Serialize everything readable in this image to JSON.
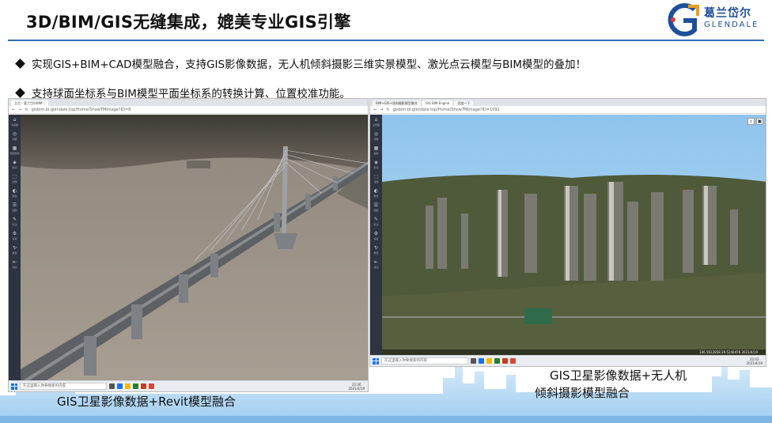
{
  "header": {
    "title": "3D/BIM/GIS无缝集成，媲美专业GIS引擎",
    "logo_cn": "葛兰岱尔",
    "logo_en": "GLENDALE"
  },
  "bullets": [
    "实现GIS+BIM+CAD模型融合，支持GIS影像数据，无人机倾斜摄影三维实景模型、激光点云模型与BIM模型的叠加！",
    "支持球面坐标系与BIM模型平面坐标系的转换计算、位置校准功能。"
  ],
  "left_window": {
    "tab": "主页 - 葛兰岱尔BIM...",
    "url": "gisbim.bl.glendale.top/Home/ShowTMImage?ID=8",
    "sidebar": [
      {
        "icon": "⌂",
        "label": "主视图"
      },
      {
        "icon": "◎",
        "label": "测量"
      },
      {
        "icon": "▦",
        "label": "模型结构"
      },
      {
        "icon": "◈",
        "label": "剖切"
      },
      {
        "icon": "⬚",
        "label": "漫游"
      },
      {
        "icon": "◐",
        "label": "属性"
      },
      {
        "icon": "☰",
        "label": "图层"
      },
      {
        "icon": "✎",
        "label": "标注"
      },
      {
        "icon": "⚙",
        "label": "设置"
      },
      {
        "icon": "↻",
        "label": "重置"
      },
      {
        "icon": "⇤",
        "label": "退出"
      }
    ],
    "taskbar_search": "在这里输入你要搜索的内容",
    "clock_time": "22:36",
    "clock_date": "2021/4/19"
  },
  "right_window": {
    "tabs": [
      "BIM+GIS+倾斜摄影模型融合",
      "GIS BIM Engine",
      "百度一下"
    ],
    "url": "gisbim.bl.glendale.top/Home/ShowTMImage?ID=1091",
    "sidebar": [
      {
        "icon": "⌂",
        "label": "主视图"
      },
      {
        "icon": "◎",
        "label": "测量"
      },
      {
        "icon": "▦",
        "label": "模型"
      },
      {
        "icon": "◈",
        "label": "剖切"
      },
      {
        "icon": "⬚",
        "label": "漫游"
      },
      {
        "icon": "◐",
        "label": "属性"
      },
      {
        "icon": "☰",
        "label": "图层"
      },
      {
        "icon": "✎",
        "label": "标注"
      },
      {
        "icon": "⚙",
        "label": "设置"
      },
      {
        "icon": "↻",
        "label": "重置"
      },
      {
        "icon": "⇤",
        "label": "退出"
      }
    ],
    "status": "106.5622858    29.5240476    2021/4/19",
    "taskbar_search": "在这里输入你要搜索的内容",
    "clock_time": "22:42",
    "clock_date": "2021/4/19"
  },
  "captions": {
    "left": "GIS卫星影像数据+Revit模型融合",
    "right_line1": "GIS卫星影像数据+无人机",
    "right_line2": "倾斜摄影模型融合"
  },
  "colors": {
    "title_rule": "#2f6fb8",
    "logo_blue": "#1d4f9a",
    "sidebar": "#2e3440",
    "sky": "#8fc4ec"
  }
}
